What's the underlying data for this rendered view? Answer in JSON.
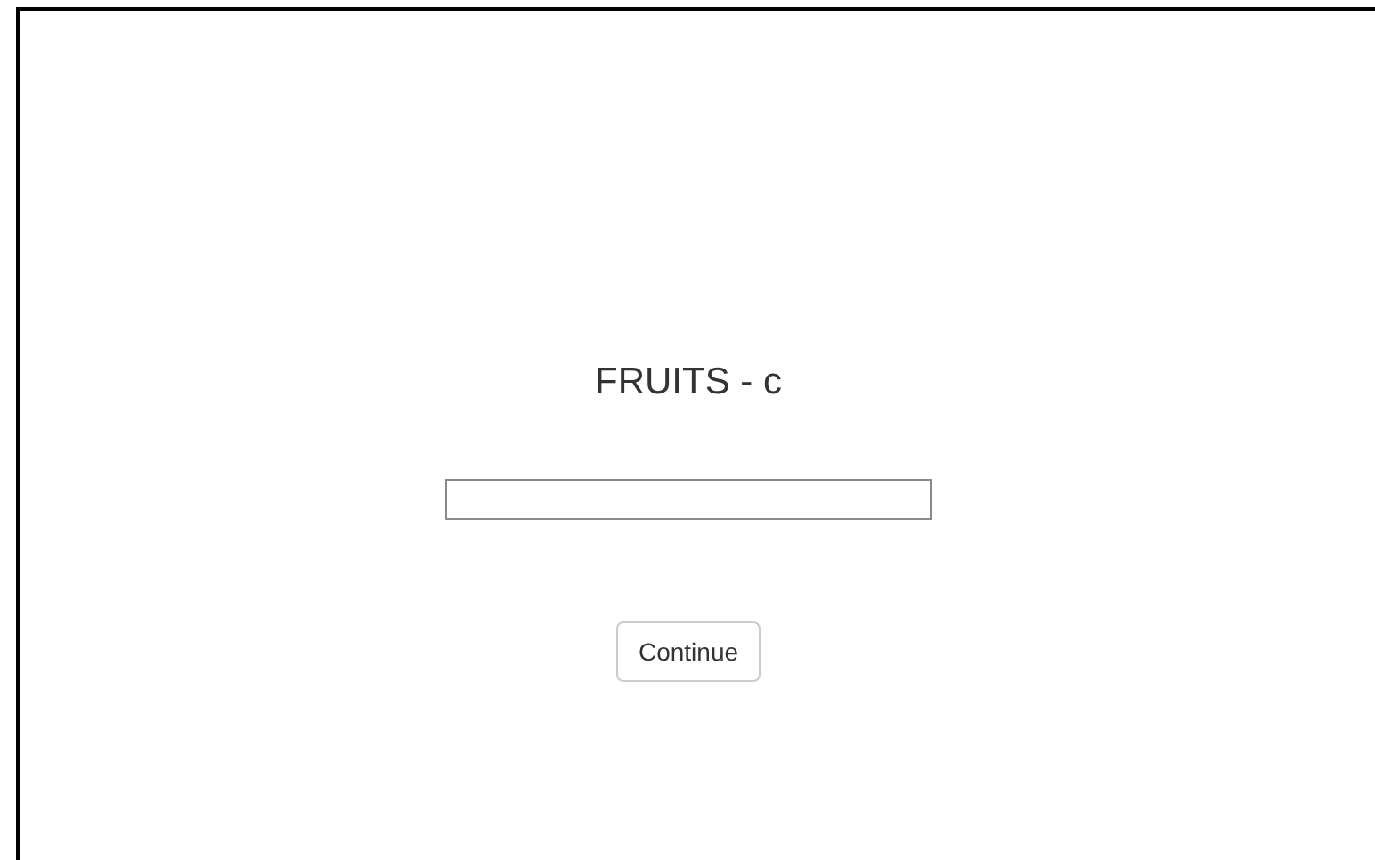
{
  "title": "FRUITS - c",
  "buttons": [
    "Continue"
  ]
}
